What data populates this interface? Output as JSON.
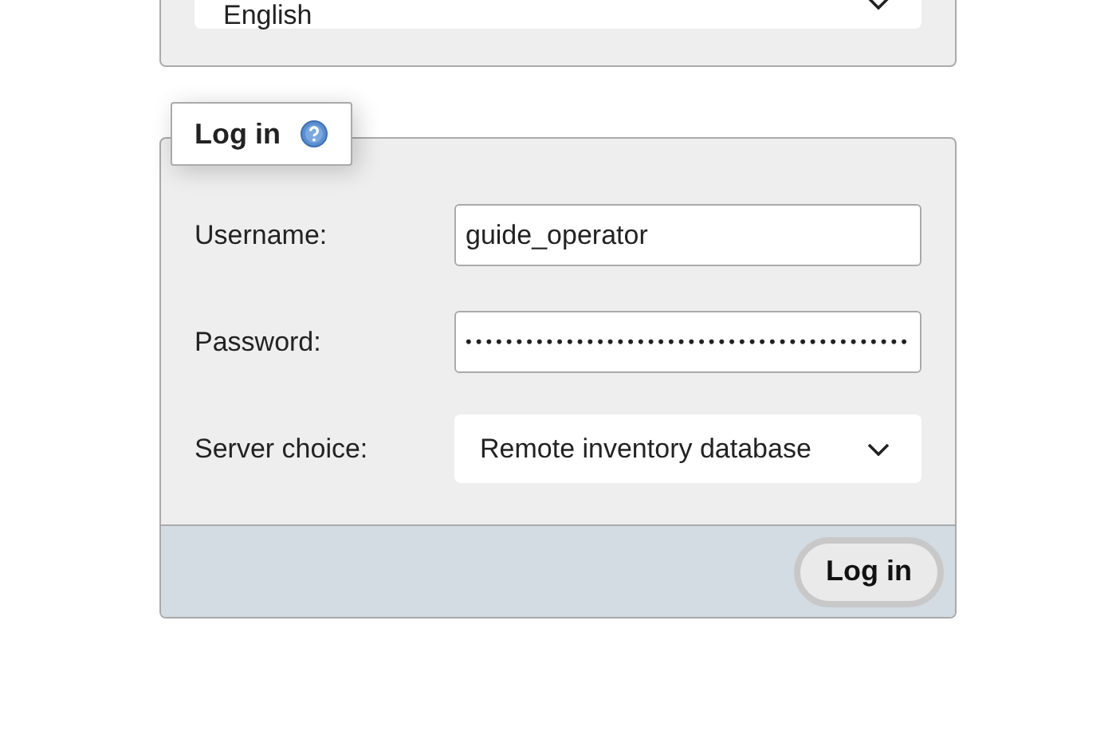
{
  "language_select": {
    "value": "English"
  },
  "login": {
    "legend": "Log in",
    "fields": [
      {
        "kind": "text",
        "label": "Username:",
        "value": "guide_operator"
      },
      {
        "kind": "password",
        "label": "Password:",
        "value": "••••••••••••••••••••••••••••••••••••••••••••"
      },
      {
        "kind": "select",
        "label": "Server choice:",
        "value": "Remote inventory database"
      }
    ],
    "submit": "Log in"
  }
}
